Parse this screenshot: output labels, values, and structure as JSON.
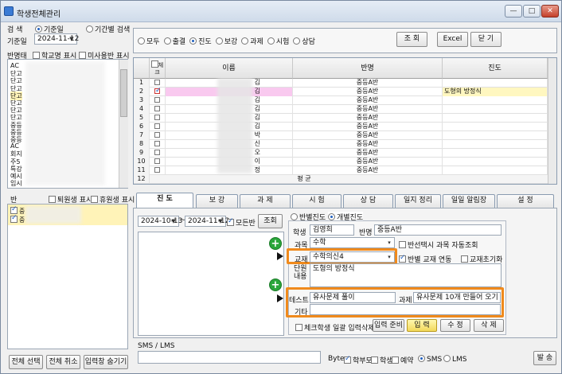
{
  "window": {
    "title": "학생전체관리",
    "min": "—",
    "max": "□",
    "close": "✕"
  },
  "left": {
    "search_label": "검  색",
    "radio_date": "기준일",
    "radio_period": "기간별 검색",
    "base_date_label": "기준일",
    "base_date": "2024-11-12",
    "class_state_label": "반명태",
    "show_school": "학교명 표시",
    "show_unpaid": "미사용반 표시",
    "class_items": [
      "AC",
      "단고",
      "단고",
      "단고",
      "단고",
      "단고",
      "단고",
      "단고",
      "중등",
      "중등",
      "중등",
      "AC",
      "회지",
      "주5",
      "특강",
      "예시",
      "임시"
    ],
    "class_section_label": "반",
    "show_withdrawn": "퇴원생 표시",
    "show_leave": "휴원생 표시",
    "student_items": [
      "중",
      "중"
    ],
    "btn_select_all": "전체 선택",
    "btn_deselect_all": "전체 취소",
    "btn_hide_input": "입력창 숨기기"
  },
  "filter": {
    "options": [
      "모두",
      "출결",
      "진도",
      "보강",
      "과제",
      "시험",
      "상담"
    ],
    "selected": "진도",
    "btn_query": "조 회",
    "btn_excel": "Excel",
    "btn_close": "닫 기"
  },
  "grid": {
    "headers": {
      "check": "체크",
      "name": "이름",
      "class": "반명",
      "progress": "진도"
    },
    "rows": [
      {
        "no": "1",
        "name": "김",
        "class": "중등A반",
        "progress": "",
        "checked": false
      },
      {
        "no": "2",
        "name": "김",
        "class": "중등A반",
        "progress": "도형의 방정식",
        "checked": true
      },
      {
        "no": "3",
        "name": "김",
        "class": "중등A반",
        "progress": "",
        "checked": false
      },
      {
        "no": "4",
        "name": "김",
        "class": "중등A반",
        "progress": "",
        "checked": false
      },
      {
        "no": "5",
        "name": "김",
        "class": "중등A반",
        "progress": "",
        "checked": false
      },
      {
        "no": "6",
        "name": "김",
        "class": "중등A반",
        "progress": "",
        "checked": false
      },
      {
        "no": "7",
        "name": "박",
        "class": "중등A반",
        "progress": "",
        "checked": false
      },
      {
        "no": "8",
        "name": "신",
        "class": "중등A반",
        "progress": "",
        "checked": false
      },
      {
        "no": "9",
        "name": "오",
        "class": "중등A반",
        "progress": "",
        "checked": false
      },
      {
        "no": "10",
        "name": "이",
        "class": "중등A반",
        "progress": "",
        "checked": false
      },
      {
        "no": "11",
        "name": "정",
        "class": "중등A반",
        "progress": "",
        "checked": false
      },
      {
        "no": "12",
        "name": "한",
        "class": "중등A반",
        "progress": "",
        "checked": false
      }
    ],
    "footer_no": "12",
    "footer_label": "평 균"
  },
  "tabs": [
    "진 도",
    "보 강",
    "과 제",
    "시 험",
    "상 담",
    "일지 정리",
    "일일 알림장",
    "설 정"
  ],
  "progress": {
    "date_from": "2024-10-13",
    "tilde": "~",
    "date_to": "2024-11-12",
    "all_classes": "모든반",
    "btn_query": "조회",
    "mode_class": "반별진도",
    "mode_individual": "개별진도",
    "student_label": "학생",
    "student_value": "김영희",
    "class_label": "반명",
    "class_value": "중등A반",
    "subject_label": "과목",
    "subject_value": "수학",
    "auto_query": "반선택시 과목 자동조회",
    "textbook_label": "교재",
    "textbook_value": "수학의신4",
    "class_textbook_link": "반별 교재 연동",
    "textbook_reset": "교재초기화",
    "unit_label": "단원\n내용",
    "unit_value": "도형의 방정식",
    "test_label": "테스트",
    "test_value": "유사문제 풀이",
    "homework_label": "과제",
    "homework_value": "유사문제 10개 만들어 오기",
    "etc_label": "기타",
    "etc_value": "",
    "bulk_input": "체크학생 일괄 입력삭제",
    "btn_prepare": "입력 준비",
    "btn_input": "입 력",
    "btn_edit": "수 정",
    "btn_delete": "삭 제"
  },
  "sms": {
    "section_label": "SMS / LMS",
    "byte_label": "Byte",
    "parent": "학부모",
    "student": "학생",
    "reserve": "예약",
    "sms": "SMS",
    "lms": "LMS",
    "btn_send": "발 송"
  },
  "colors": {
    "highlight_row": "#f9c9ef",
    "progress_cell": "#fff7c0",
    "orange_box": "#f08a1c",
    "green_plus": "#2aa63a"
  }
}
